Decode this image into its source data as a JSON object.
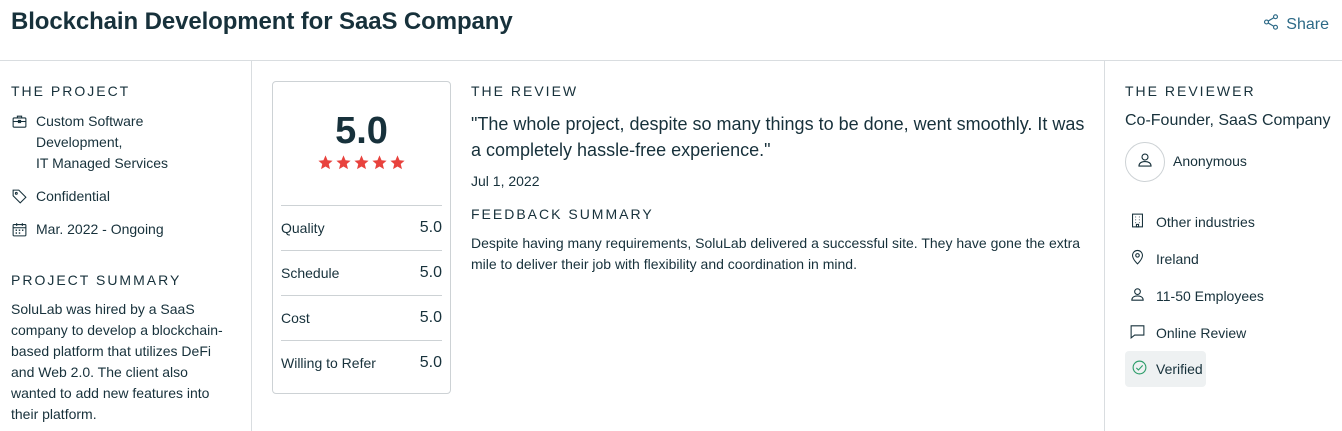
{
  "header": {
    "title": "Blockchain Development for SaaS Company",
    "share_label": "Share"
  },
  "project": {
    "section_label": "THE PROJECT",
    "services": [
      "Custom Software",
      "Development,",
      "IT Managed Services"
    ],
    "budget": "Confidential",
    "dates": "Mar. 2022 - Ongoing",
    "summary_label": "PROJECT SUMMARY",
    "summary": "SoluLab was hired by a SaaS company to develop a blockchain-based platform that utilizes DeFi and Web 2.0. The client also wanted to add new features into their platform."
  },
  "rating": {
    "overall": "5.0",
    "stars": 5,
    "star_color": "#e8423d",
    "rows": [
      {
        "label": "Quality",
        "value": "5.0"
      },
      {
        "label": "Schedule",
        "value": "5.0"
      },
      {
        "label": "Cost",
        "value": "5.0"
      },
      {
        "label": "Willing to Refer",
        "value": "5.0"
      }
    ]
  },
  "review": {
    "section_label": "THE REVIEW",
    "quote": "\"The whole project, despite so many things to be done, went smoothly. It was a completely hassle-free experience.\"",
    "date": "Jul 1, 2022",
    "feedback_label": "FEEDBACK SUMMARY",
    "feedback": "Despite having many requirements, SoluLab delivered a successful site. They have gone the extra mile to deliver their job with flexibility and coordination in mind."
  },
  "reviewer": {
    "section_label": "THE REVIEWER",
    "role": "Co-Founder, SaaS Company",
    "name": "Anonymous",
    "industry": "Other industries",
    "location": "Ireland",
    "size": "11-50 Employees",
    "review_type": "Online Review",
    "verified": "Verified"
  },
  "colors": {
    "text": "#17313b",
    "link": "#2d6a87",
    "verified_check": "#2e9e6b",
    "divider": "#d9dde0"
  }
}
